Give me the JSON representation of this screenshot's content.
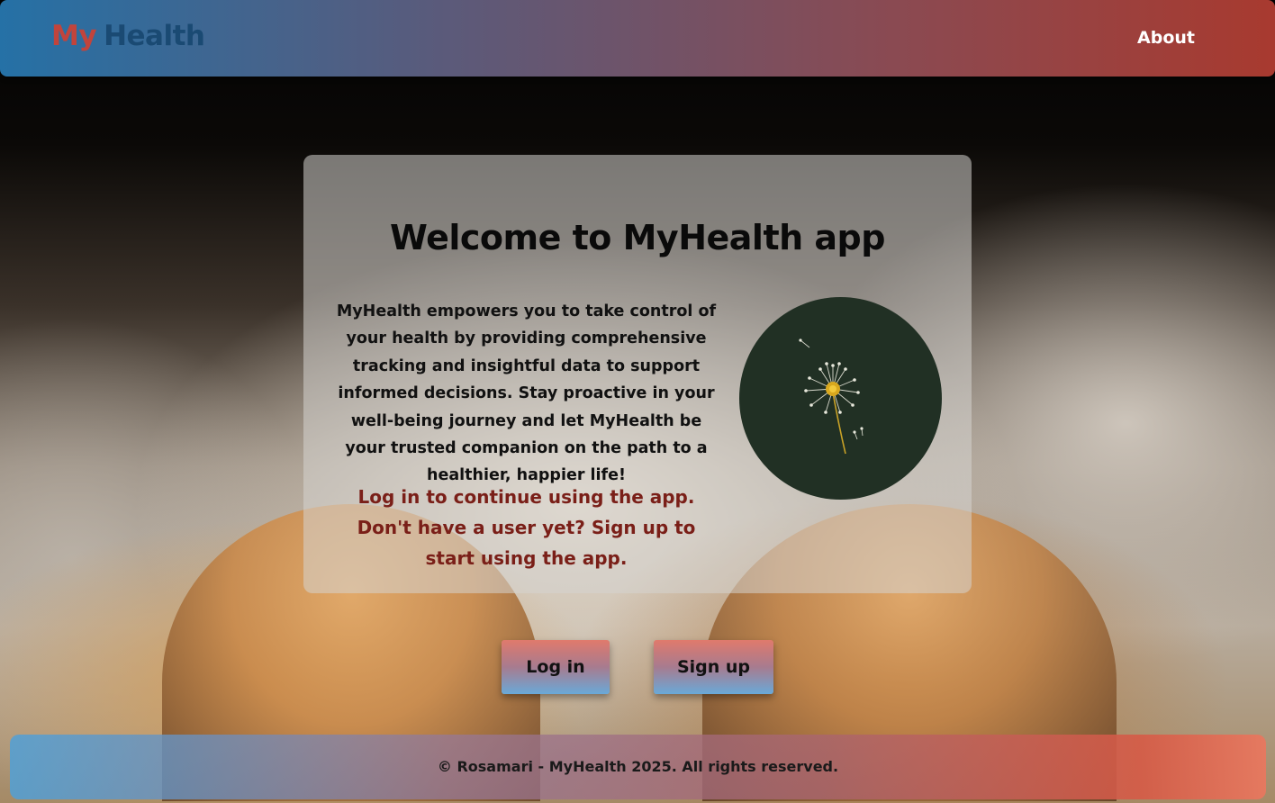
{
  "header": {
    "brand_first": "My",
    "brand_second": "Health",
    "nav_about": "About"
  },
  "card": {
    "title": "Welcome to MyHealth app",
    "description": "MyHealth empowers you to take control of your health by providing comprehensive tracking and insightful data to support informed decisions. Stay proactive in your well-being journey and let MyHealth be your trusted companion on the path to a healthier, happier life!",
    "cta": "Log in to continue using the app. Don't have a user yet? Sign up to start using the app.",
    "image_icon": "dandelion-illustration"
  },
  "buttons": {
    "login": "Log in",
    "signup": "Sign up"
  },
  "footer": {
    "text": "© Rosamari - MyHealth 2025. All rights reserved."
  },
  "colors": {
    "header_start": "#2571a6",
    "header_end": "#a83a2f",
    "brand_my": "#c1443c",
    "brand_health": "#1a4a73",
    "cta_text": "#7a1f18",
    "dandelion_bg": "#213024"
  }
}
